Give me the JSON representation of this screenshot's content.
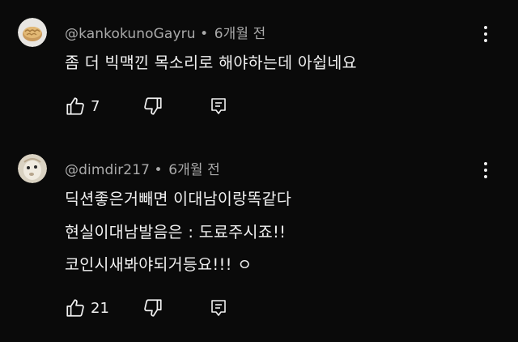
{
  "comments": [
    {
      "author": "@kankokunoGayru",
      "separator": "•",
      "time": "6개월 전",
      "lines": [
        "좀 더 빅맥낀 목소리로 해야하는데 아쉽네요"
      ],
      "likes": "7",
      "avatar_icon": "bun-avatar-icon"
    },
    {
      "author": "@dimdir217",
      "separator": "•",
      "time": "6개월 전",
      "lines": [
        "딕션좋은거빼면 이대남이랑똑같다",
        "현실이대남발음은 : 도료주시죠!!",
        "코인시새봐야되거등요!!! ㅇ"
      ],
      "likes": "21",
      "avatar_icon": "creature-avatar-icon"
    }
  ],
  "colors": {
    "background": "#0a0a0a",
    "text": "#f1f1f1",
    "meta": "#aaaaaa"
  }
}
